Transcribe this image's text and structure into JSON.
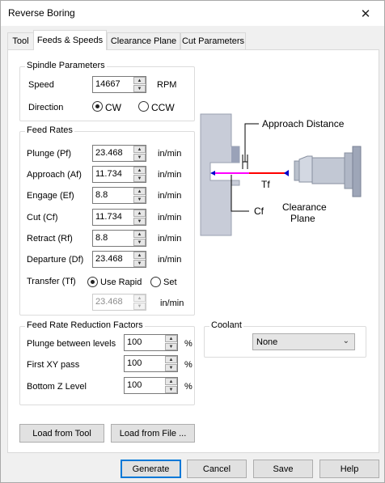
{
  "window": {
    "title": "Reverse Boring"
  },
  "tabs": [
    {
      "label": "Tool"
    },
    {
      "label": "Feeds & Speeds"
    },
    {
      "label": "Clearance Plane"
    },
    {
      "label": "Cut Parameters"
    }
  ],
  "spindle": {
    "title": "Spindle Parameters",
    "speed_label": "Speed",
    "speed_value": "14667",
    "speed_unit": "RPM",
    "direction_label": "Direction",
    "cw_label": "CW",
    "ccw_label": "CCW",
    "direction_selected": "CW"
  },
  "feed_rates": {
    "title": "Feed Rates",
    "rows": [
      {
        "label": "Plunge (Pf)",
        "value": "23.468",
        "unit": "in/min"
      },
      {
        "label": "Approach (Af)",
        "value": "11.734",
        "unit": "in/min"
      },
      {
        "label": "Engage (Ef)",
        "value": "8.8",
        "unit": "in/min"
      },
      {
        "label": "Cut (Cf)",
        "value": "11.734",
        "unit": "in/min"
      },
      {
        "label": "Retract (Rf)",
        "value": "8.8",
        "unit": "in/min"
      },
      {
        "label": "Departure  (Df)",
        "value": "23.468",
        "unit": "in/min"
      }
    ],
    "transfer_label": "Transfer (Tf)",
    "use_rapid_label": "Use Rapid",
    "set_label": "Set",
    "transfer_selected": "Use Rapid",
    "transfer_value": "23.468",
    "transfer_unit": "in/min"
  },
  "reduction": {
    "title": "Feed Rate Reduction Factors",
    "rows": [
      {
        "label": "Plunge between levels",
        "value": "100",
        "unit": "%"
      },
      {
        "label": "First XY pass",
        "value": "100",
        "unit": "%"
      },
      {
        "label": "Bottom Z Level",
        "value": "100",
        "unit": "%"
      }
    ]
  },
  "coolant": {
    "title": "Coolant",
    "value": "None"
  },
  "illustration": {
    "approach_distance": "Approach Distance",
    "tf": "Tf",
    "cf": "Cf",
    "clearance_line1": "Clearance",
    "clearance_line2": "Plane"
  },
  "buttons": {
    "load_from_tool": "Load from Tool",
    "load_from_file": "Load from File ...",
    "generate": "Generate",
    "cancel": "Cancel",
    "save": "Save",
    "help": "Help"
  },
  "colors": {
    "tf_line": "#ff0000",
    "cf_line": "#ff00ff",
    "arrow": "#0000cc",
    "default_button_border": "#0078d7"
  },
  "icons": [
    "close-icon",
    "spin-up-icon",
    "spin-down-icon",
    "chevron-down-icon"
  ]
}
